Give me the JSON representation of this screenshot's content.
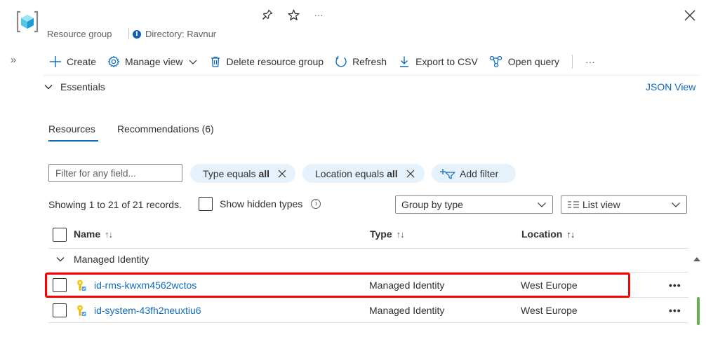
{
  "header": {
    "subtitle": "Resource group",
    "directory": "Directory: Ravnur",
    "more": "···"
  },
  "toolbar": {
    "create": "Create",
    "manage_view": "Manage view",
    "delete": "Delete resource group",
    "refresh": "Refresh",
    "export": "Export to CSV",
    "open_query": "Open query",
    "more": "···"
  },
  "essentials": {
    "label": "Essentials",
    "json_view": "JSON View"
  },
  "tabs": [
    {
      "label": "Resources",
      "active": true
    },
    {
      "label": "Recommendations (6)",
      "active": false
    }
  ],
  "filters": {
    "placeholder": "Filter for any field...",
    "type_pill": {
      "prefix": "Type equals",
      "value": "all"
    },
    "location_pill": {
      "prefix": "Location equals",
      "value": "all"
    },
    "add_filter": "Add filter"
  },
  "records": {
    "summary": "Showing 1 to 21 of 21 records.",
    "show_hidden": "Show hidden types",
    "group_by": "Group by type",
    "view": "List view"
  },
  "table": {
    "columns": {
      "name": "Name",
      "type": "Type",
      "location": "Location"
    },
    "sort_up": "↑↓",
    "group": "Managed Identity",
    "rows": [
      {
        "name": "id-rms-kwxm4562wctos",
        "type": "Managed Identity",
        "location": "West Europe",
        "more": "•••"
      },
      {
        "name": "id-system-43fh2neuxtiu6",
        "type": "Managed Identity",
        "location": "West Europe",
        "more": "•••"
      }
    ]
  },
  "colors": {
    "accent": "#0f6cbd",
    "pill_bg": "#e6f2fb",
    "highlight": "#ff0000"
  }
}
